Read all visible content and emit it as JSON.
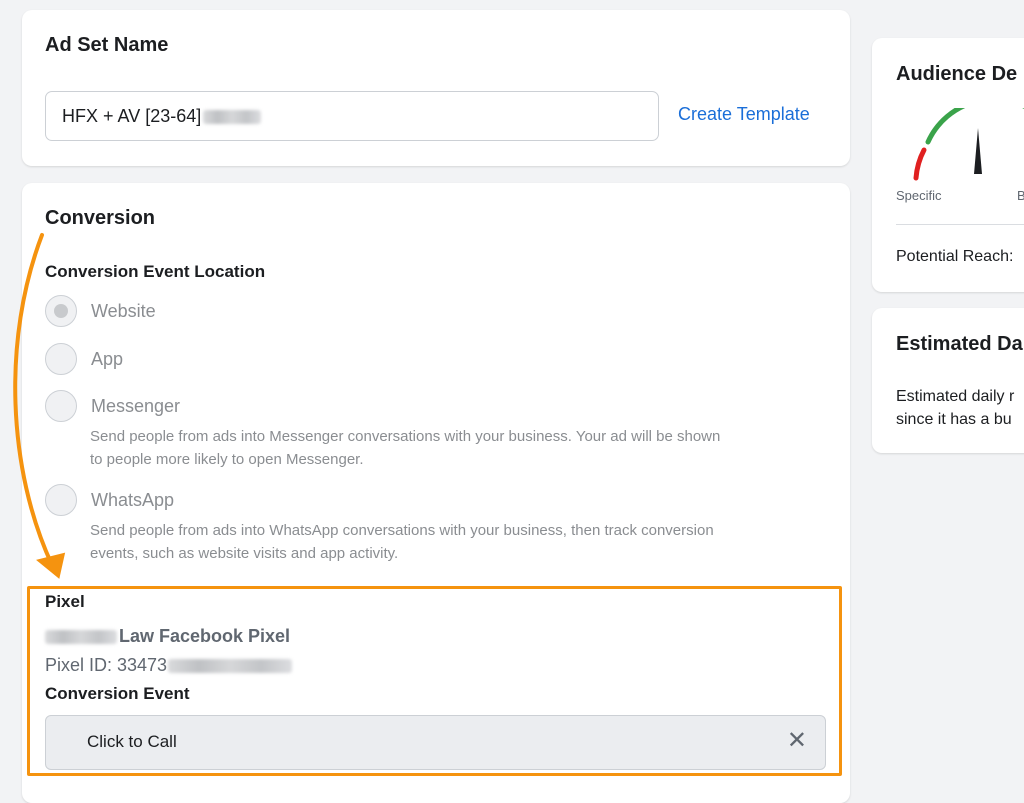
{
  "ad_set": {
    "title": "Ad Set Name",
    "name_value": "HFX + AV [23-64]",
    "create_template_link": "Create Template"
  },
  "conversion": {
    "title": "Conversion",
    "location_title": "Conversion Event Location",
    "options": [
      {
        "label": "Website",
        "checked": true,
        "description": ""
      },
      {
        "label": "App",
        "checked": false,
        "description": ""
      },
      {
        "label": "Messenger",
        "checked": false,
        "description_lines": [
          "Send people from ads into Messenger conversations with your business. Your ad will be shown",
          "to people more likely to open Messenger."
        ]
      },
      {
        "label": "WhatsApp",
        "checked": false,
        "description_lines": [
          "Send people from ads into WhatsApp conversations with your business, then track conversion",
          "events, such as website visits and app activity."
        ]
      }
    ],
    "pixel_title": "Pixel",
    "pixel_name_suffix": "Law Facebook Pixel",
    "pixel_id_prefix": "Pixel ID: 33473",
    "event_title": "Conversion Event",
    "event_value": "Click to Call"
  },
  "audience": {
    "title": "Audience De",
    "gauge_left_label": "Specific",
    "gauge_right_label": "B",
    "potential_reach_label": "Potential Reach:"
  },
  "estimated": {
    "title": "Estimated Da",
    "text_line1": "Estimated daily r",
    "text_line2": "since it has a bu"
  },
  "colors": {
    "highlight": "#f5930f",
    "link": "#1a6ed8",
    "gauge_red": "#e02020",
    "gauge_green": "#3aa34a"
  }
}
